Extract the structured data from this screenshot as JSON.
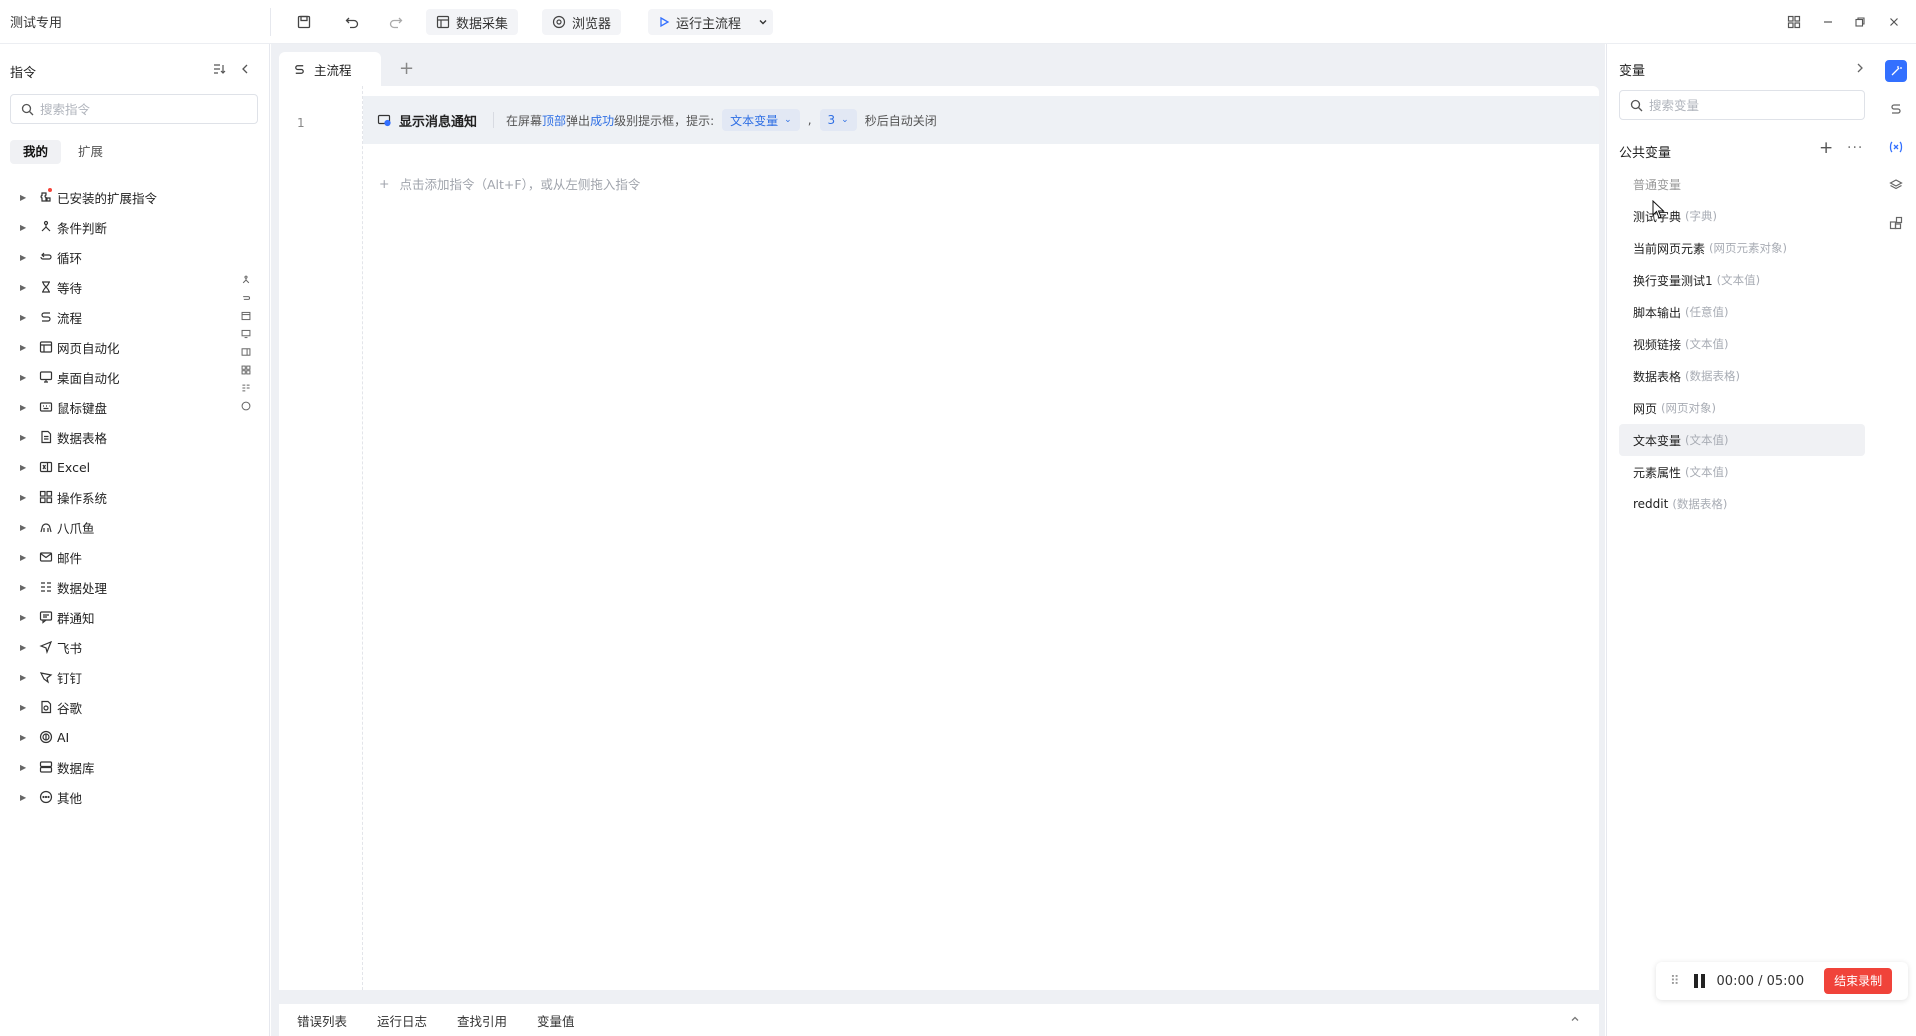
{
  "app": {
    "title": "测试专用"
  },
  "toolbar": {
    "data_collect": "数据采集",
    "browser": "浏览器",
    "run_main": "运行主流程"
  },
  "left_panel": {
    "title": "指令",
    "search_placeholder": "搜索指令",
    "tabs": [
      "我的",
      "扩展"
    ],
    "items": [
      {
        "label": "已安装的扩展指令",
        "icon": "extension-icon"
      },
      {
        "label": "条件判断",
        "icon": "branch-icon"
      },
      {
        "label": "循环",
        "icon": "loop-icon"
      },
      {
        "label": "等待",
        "icon": "hourglass-icon"
      },
      {
        "label": "流程",
        "icon": "flow-icon"
      },
      {
        "label": "网页自动化",
        "icon": "webpage-icon"
      },
      {
        "label": "桌面自动化",
        "icon": "desktop-icon"
      },
      {
        "label": "鼠标键盘",
        "icon": "keyboard-icon"
      },
      {
        "label": "数据表格",
        "icon": "table-icon"
      },
      {
        "label": "Excel",
        "icon": "excel-icon"
      },
      {
        "label": "操作系统",
        "icon": "os-icon"
      },
      {
        "label": "八爪鱼",
        "icon": "octopus-icon"
      },
      {
        "label": "邮件",
        "icon": "mail-icon"
      },
      {
        "label": "数据处理",
        "icon": "data-process-icon"
      },
      {
        "label": "群通知",
        "icon": "group-notify-icon"
      },
      {
        "label": "飞书",
        "icon": "feishu-icon"
      },
      {
        "label": "钉钉",
        "icon": "dingtalk-icon"
      },
      {
        "label": "谷歌",
        "icon": "google-icon"
      },
      {
        "label": "AI",
        "icon": "ai-icon"
      },
      {
        "label": "数据库",
        "icon": "database-icon"
      },
      {
        "label": "其他",
        "icon": "more-icon"
      }
    ]
  },
  "editor": {
    "tab_label": "主流程",
    "line_number": "1",
    "command": {
      "title": "显示消息通知",
      "t1": "在屏幕",
      "pos": "顶部",
      "t2": "弹出",
      "level": "成功",
      "t3": "级别提示框，提示:",
      "var_pill": "文本变量",
      "comma": ",",
      "seconds_pill": "3",
      "t4": "秒后自动关闭"
    },
    "add_hint": "点击添加指令（Alt+F），或从左侧拖入指令"
  },
  "bottom_tabs": [
    "错误列表",
    "运行日志",
    "查找引用",
    "变量值"
  ],
  "right_panel": {
    "title": "变量",
    "search_placeholder": "搜索变量",
    "section_title": "公共变量",
    "variables": [
      {
        "name": "普通变量",
        "type": ""
      },
      {
        "name": "测试字典",
        "type": "(字典)"
      },
      {
        "name": "当前网页元素",
        "type": "(网页元素对象)"
      },
      {
        "name": "换行变量测试1",
        "type": "(文本值)"
      },
      {
        "name": "脚本输出",
        "type": "(任意值)"
      },
      {
        "name": "视频链接",
        "type": "(文本值)"
      },
      {
        "name": "数据表格",
        "type": "(数据表格)"
      },
      {
        "name": "网页",
        "type": "(网页对象)"
      },
      {
        "name": "文本变量",
        "type": "(文本值)"
      },
      {
        "name": "元素属性",
        "type": "(文本值)"
      },
      {
        "name": "reddit",
        "type": "(数据表格)"
      }
    ]
  },
  "recording": {
    "timer": "00:00 / 05:00",
    "stop_label": "结束录制"
  },
  "colors": {
    "accent": "#3370ff",
    "link": "#2f6fe4",
    "stop": "#f0433a"
  }
}
